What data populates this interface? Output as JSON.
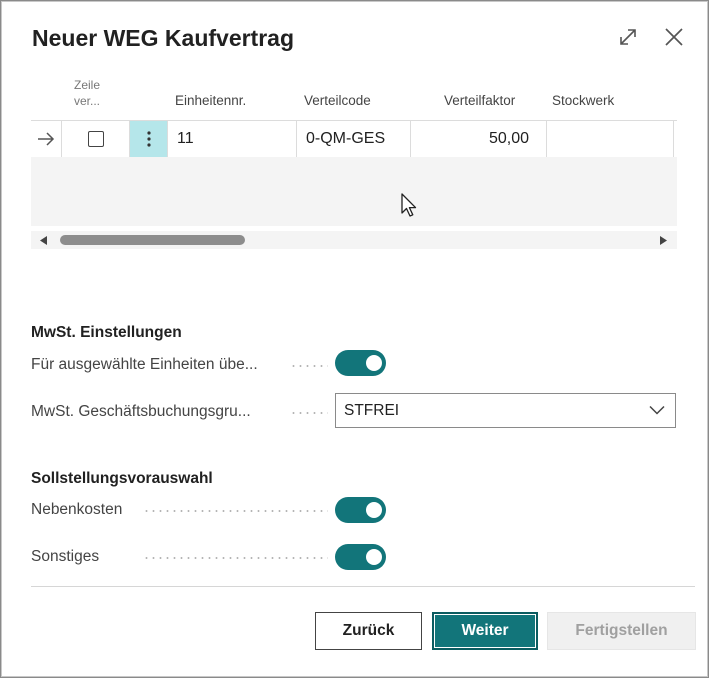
{
  "dialog": {
    "title": "Neuer WEG Kaufvertrag"
  },
  "grid": {
    "columns": {
      "select_label": "Zeile ver...",
      "select_label_line1": "Zeile",
      "select_label_line2": "ver...",
      "unit": "Einheitennr.",
      "dist_code": "Verteilcode",
      "dist_factor": "Verteilfaktor",
      "floor": "Stockwerk"
    },
    "rows": [
      {
        "unit": "11",
        "dist_code": "0-QM-GES",
        "dist_factor": "50,00",
        "floor": ""
      }
    ]
  },
  "vat": {
    "heading": "MwSt. Einstellungen",
    "apply_label": "Für ausgewählte Einheiten übe...",
    "apply_value": true,
    "posting_group_label": "MwSt. Geschäftsbuchungsgru...",
    "posting_group_value": "STFREI"
  },
  "preselection": {
    "heading": "Sollstellungsvorauswahl",
    "ancillary_label": "Nebenkosten",
    "ancillary_value": true,
    "other_label": "Sonstiges",
    "other_value": true
  },
  "buttons": {
    "back": "Zurück",
    "next": "Weiter",
    "finish": "Fertigstellen"
  },
  "colors": {
    "accent": "#12757a",
    "active_cell": "#b5e6ea",
    "disabled_button_bg": "#f0f0f0",
    "disabled_button_text": "#a0a0a0"
  },
  "icons": {
    "expand": "expand-icon",
    "close": "close-icon",
    "row_arrow": "arrow-right-icon",
    "row_menu": "vertical-dots-icon",
    "dropdown": "chevron-down-icon",
    "scroll_left": "triangle-left-icon",
    "scroll_right": "triangle-right-icon",
    "cursor": "mouse-pointer-icon"
  }
}
